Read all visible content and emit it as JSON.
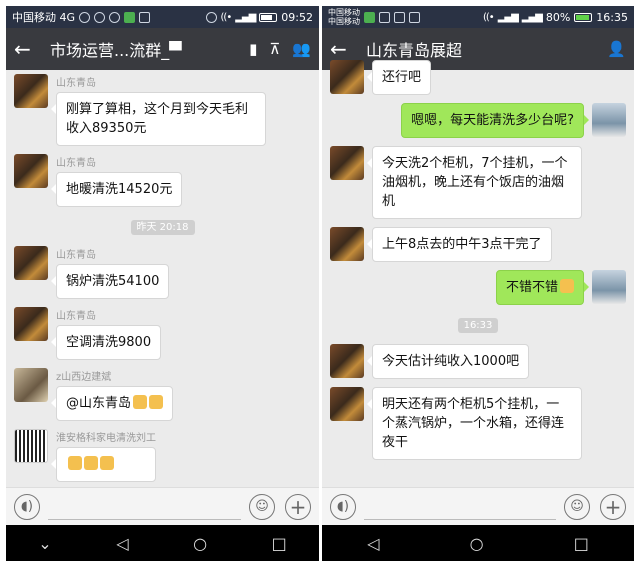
{
  "left": {
    "status": {
      "carrier": "中国移动 4G",
      "time": "09:52"
    },
    "title": "市场运营...流群_▀",
    "messages": [
      {
        "type": "in",
        "sender": "山东青岛",
        "text": "刚算了算相，这个月到今天毛利收入89350元",
        "avatar": "warrior"
      },
      {
        "type": "in",
        "sender": "山东青岛",
        "text": "地暖清洗14520元",
        "avatar": "warrior"
      },
      {
        "type": "time",
        "text": "昨天 20:18"
      },
      {
        "type": "in",
        "sender": "山东青岛",
        "text": "锅炉清洗54100",
        "avatar": "warrior"
      },
      {
        "type": "in",
        "sender": "山东青岛",
        "text": "空调清洗9800",
        "avatar": "warrior"
      },
      {
        "type": "in",
        "sender": "z山西边建斌",
        "text": "@山东青岛",
        "thumbs": 2,
        "avatar": "room"
      },
      {
        "type": "in",
        "sender": "淮安格科家电清洗刘工",
        "text": "",
        "thumbs": 3,
        "avatar": "qr"
      }
    ]
  },
  "right": {
    "status": {
      "carrier_line1": "中国移动",
      "carrier_line2": "中国移动",
      "battery": "80%",
      "time": "16:35"
    },
    "title": "山东青岛展超",
    "messages": [
      {
        "type": "in",
        "text": "还行吧",
        "avatar": "warrior"
      },
      {
        "type": "out",
        "text": "嗯嗯，每天能清洗多少台呢?",
        "avatar": "me"
      },
      {
        "type": "in",
        "text": "今天洗2个柜机，7个挂机，一个油烟机，晚上还有个饭店的油烟机",
        "avatar": "warrior"
      },
      {
        "type": "in",
        "text": "上午8点去的中午3点干完了",
        "avatar": "warrior"
      },
      {
        "type": "out",
        "text": "不错不错",
        "thumbs": 1,
        "avatar": "me"
      },
      {
        "type": "time",
        "text": "16:33"
      },
      {
        "type": "in",
        "text": "今天估计纯收入1000吧",
        "avatar": "warrior"
      },
      {
        "type": "in",
        "text": "明天还有两个柜机5个挂机，一个蒸汽锅炉，一个水箱，还得连夜干",
        "avatar": "warrior"
      }
    ]
  },
  "icons": {
    "back": "←",
    "voice": "◖)",
    "emoji": "☺",
    "plus": "+",
    "nav_down": "⌄",
    "nav_back": "◁",
    "nav_home": "○",
    "nav_recent": "□"
  }
}
